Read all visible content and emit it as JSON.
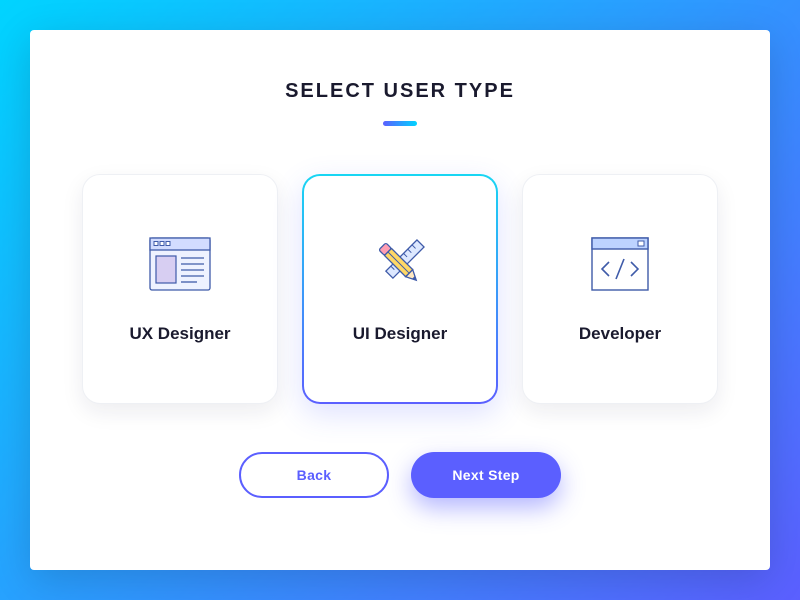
{
  "heading": "SELECT USER TYPE",
  "options": [
    {
      "label": "UX Designer",
      "icon": "wireframe-icon",
      "selected": false
    },
    {
      "label": "UI Designer",
      "icon": "pencil-ruler-icon",
      "selected": true
    },
    {
      "label": "Developer",
      "icon": "code-window-icon",
      "selected": false
    }
  ],
  "buttons": {
    "back": "Back",
    "next": "Next Step"
  },
  "colors": {
    "accent_blue": "#00D4FF",
    "accent_purple": "#5B5FFF",
    "text": "#1a1a2e"
  }
}
